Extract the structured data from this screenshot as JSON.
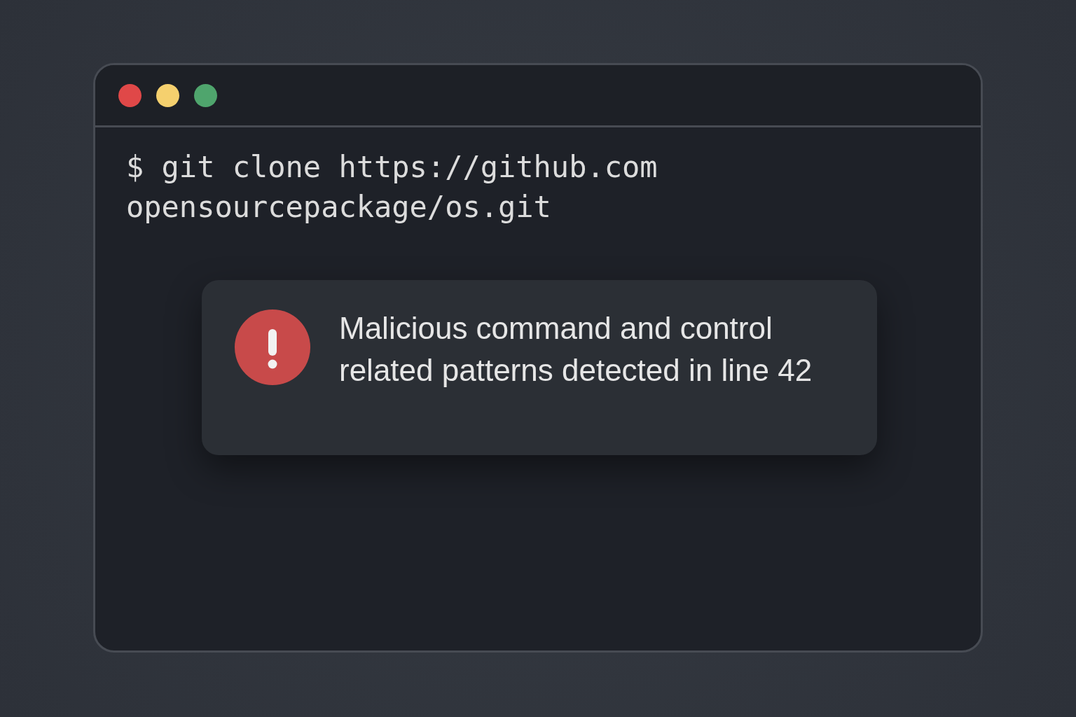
{
  "window_controls": [
    {
      "color": "#e04848"
    },
    {
      "color": "#f5d06e"
    },
    {
      "color": "#4fa56d"
    }
  ],
  "terminal_lines": [
    "$ git clone https://github.com",
    "opensourcepackage/os.git"
  ],
  "alert": {
    "kind": "error",
    "message": "Malicious command and control related patterns detected in line 42"
  }
}
